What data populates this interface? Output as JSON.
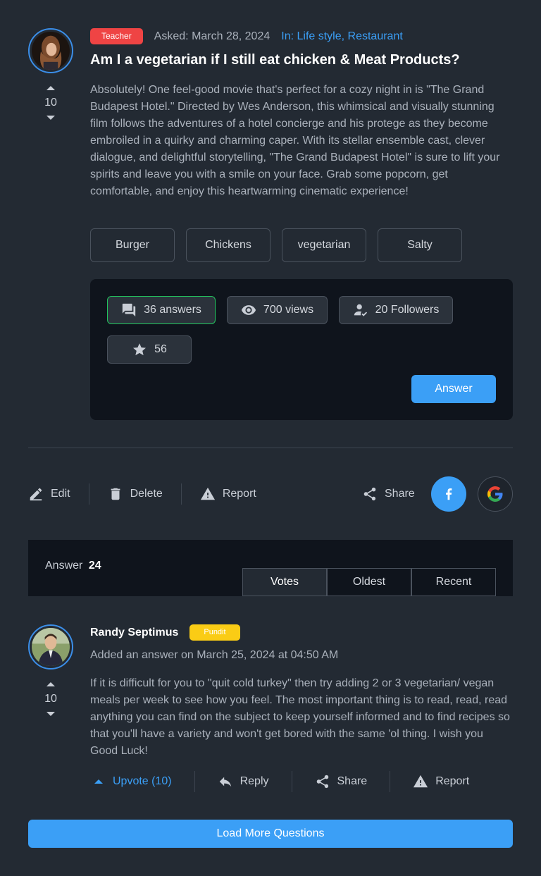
{
  "question": {
    "badge": "Teacher",
    "asked": "Asked: March 28, 2024",
    "category": "In: Life style, Restaurant",
    "title": "Am I a vegetarian if I still eat chicken & Meat Products?",
    "body": "Absolutely! One feel-good movie that's perfect for a cozy night in is \"The Grand Budapest Hotel.\" Directed by Wes Anderson, this whimsical and visually stunning film follows the adventures of a hotel concierge and his protege as they become embroiled in a quirky and charming caper. With its stellar ensemble cast, clever dialogue, and delightful storytelling, \"The Grand Budapest Hotel\" is sure to lift your spirits and leave you with a smile on your face. Grab some popcorn, get comfortable, and enjoy this heartwarming cinematic experience!",
    "votes": "10",
    "tags": [
      "Burger",
      "Chickens",
      "vegetarian",
      "Salty"
    ],
    "stats": {
      "answers": "36 answers",
      "views": "700 views",
      "followers": "20 Followers",
      "stars": "56"
    },
    "answer_button": "Answer"
  },
  "actions": {
    "edit": "Edit",
    "delete": "Delete",
    "report": "Report",
    "share": "Share"
  },
  "answers_section": {
    "label": "Answer",
    "count": "24",
    "tabs": [
      "Votes",
      "Oldest",
      "Recent"
    ],
    "active_tab": "Votes"
  },
  "answer": {
    "author": "Randy Septimus",
    "badge": "Pundit",
    "added": "Added an answer on March 25, 2024 at 04:50 AM",
    "votes": "10",
    "body": "If it is difficult for you to \"quit cold turkey\" then try adding 2 or 3 vegetarian/ vegan meals per week to see how you feel. The most important thing is to read, read, read anything you can find on the subject to keep yourself informed and to find recipes so that you'll have a variety and won't get bored with the same 'ol thing. I wish you Good Luck!",
    "upvote": "Upvote (10)",
    "reply": "Reply",
    "share": "Share",
    "report": "Report"
  },
  "load_more": "Load More Questions",
  "colors": {
    "background": "#232a33",
    "panel": "#0f141c",
    "accent": "#3b9ff6",
    "teacher_badge": "#ef4444",
    "pundit_badge": "#facc15",
    "answers_border": "#22c55e"
  }
}
